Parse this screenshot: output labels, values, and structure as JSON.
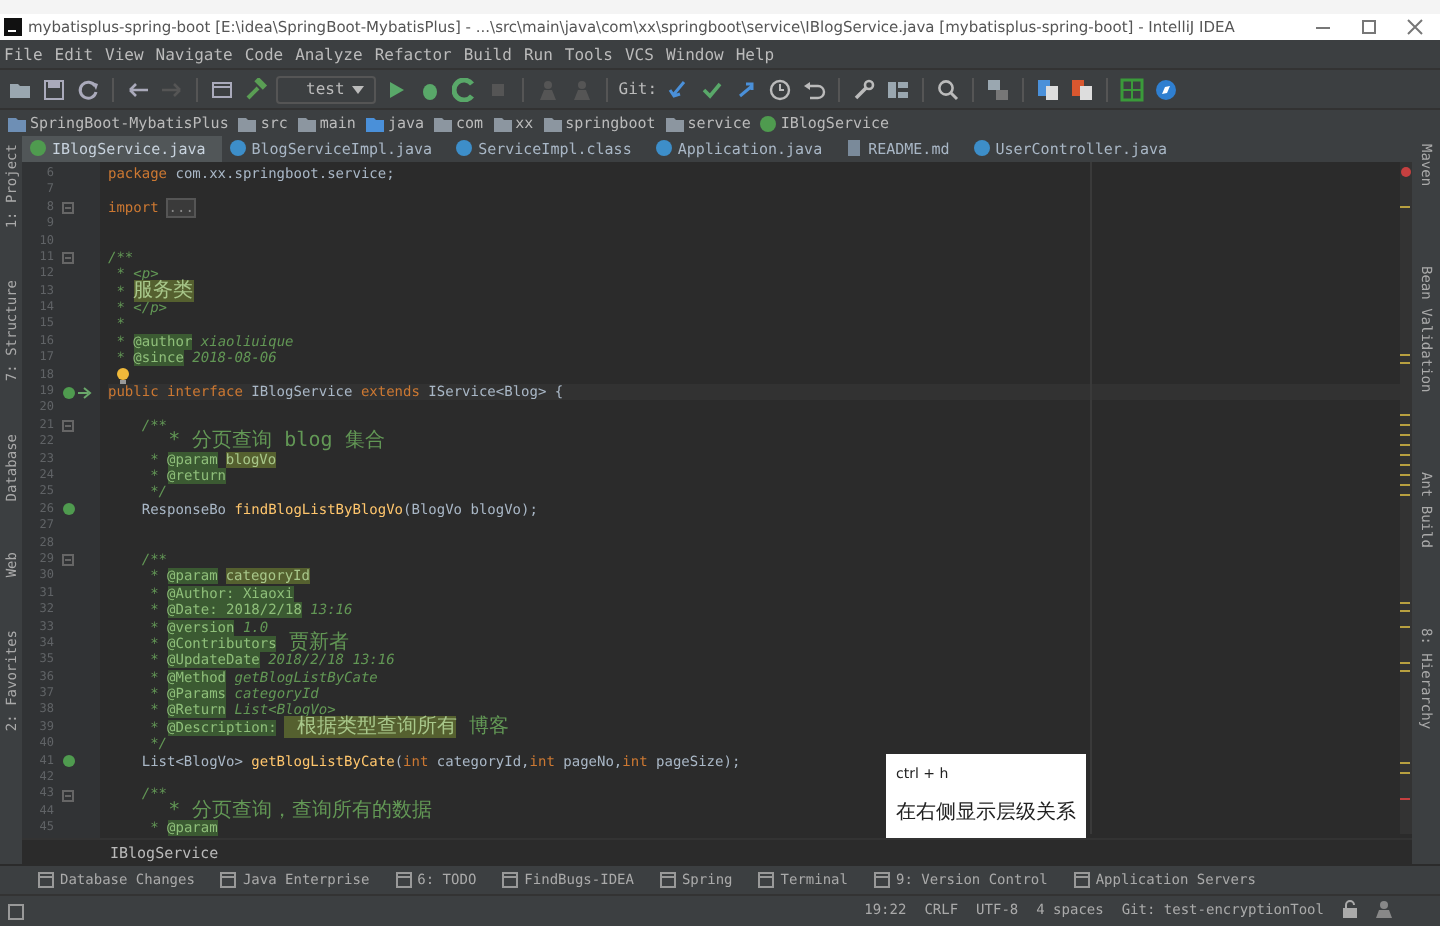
{
  "window": {
    "title": "mybatisplus-spring-boot [E:\\idea\\SpringBoot-MybatisPlus] - ...\\src\\main\\java\\com\\xx\\springboot\\service\\IBlogService.java [mybatisplus-spring-boot] - IntelliJ IDEA"
  },
  "menu": [
    "File",
    "Edit",
    "View",
    "Navigate",
    "Code",
    "Analyze",
    "Refactor",
    "Build",
    "Run",
    "Tools",
    "VCS",
    "Window",
    "Help"
  ],
  "toolbar": {
    "run_config": "test",
    "vcs_label": "Git:"
  },
  "navigation": [
    {
      "label": "SpringBoot-MybatisPlus",
      "kind": "module"
    },
    {
      "label": "src",
      "kind": "folder"
    },
    {
      "label": "main",
      "kind": "folder"
    },
    {
      "label": "java",
      "kind": "source"
    },
    {
      "label": "com",
      "kind": "folder"
    },
    {
      "label": "xx",
      "kind": "folder"
    },
    {
      "label": "springboot",
      "kind": "folder"
    },
    {
      "label": "service",
      "kind": "folder"
    },
    {
      "label": "IBlogService",
      "kind": "interface"
    }
  ],
  "tabs": [
    {
      "label": "IBlogService.java",
      "kind": "interface",
      "selected": true
    },
    {
      "label": "BlogServiceImpl.java",
      "kind": "class",
      "selected": false
    },
    {
      "label": "ServiceImpl.class",
      "kind": "class",
      "selected": false
    },
    {
      "label": "Application.java",
      "kind": "class",
      "selected": false
    },
    {
      "label": "README.md",
      "kind": "markdown",
      "selected": false
    },
    {
      "label": "UserController.java",
      "kind": "class",
      "selected": false
    }
  ],
  "left_tools": [
    "1: Project",
    "7: Structure",
    "Database",
    "Web",
    "2: Favorites"
  ],
  "right_tools": [
    "Maven",
    "Bean Validation",
    "Ant Build",
    "8: Hierarchy"
  ],
  "code": [
    {
      "number": "6",
      "tokens": [
        {
          "text": "package",
          "kind": "keyword"
        },
        {
          "text": " com.xx.springboot.service;",
          "kind": "plain"
        }
      ]
    },
    {
      "number": "7"
    },
    {
      "number": "8",
      "foldable": true,
      "tokens": [
        {
          "text": "import",
          "kind": "keyword"
        },
        {
          "text": "...",
          "kind": "folded"
        }
      ]
    },
    {
      "number": "9"
    },
    {
      "number": "10"
    },
    {
      "number": "11",
      "foldable": true,
      "tokens": [
        {
          "text": "/**",
          "kind": "doc"
        }
      ]
    },
    {
      "number": "12",
      "tokens": [
        {
          "text": " * <p>",
          "kind": "doc"
        }
      ]
    },
    {
      "number": "13",
      "tokens": [
        {
          "text": " * ",
          "kind": "doc"
        },
        {
          "text": "服务类",
          "kind": "param"
        }
      ]
    },
    {
      "number": "14",
      "tokens": [
        {
          "text": " * </p>",
          "kind": "doc"
        }
      ]
    },
    {
      "number": "15",
      "tokens": [
        {
          "text": " *",
          "kind": "doc"
        }
      ]
    },
    {
      "number": "16",
      "tokens": [
        {
          "text": " * ",
          "kind": "doc"
        },
        {
          "text": "@author",
          "kind": "tag"
        },
        {
          "text": " xiaoliuique",
          "kind": "doc"
        }
      ]
    },
    {
      "number": "17",
      "tokens": [
        {
          "text": " * ",
          "kind": "doc"
        },
        {
          "text": "@since",
          "kind": "tag"
        },
        {
          "text": " 2018-08-06",
          "kind": "doc"
        }
      ]
    },
    {
      "number": "18",
      "intention": true
    },
    {
      "number": "19",
      "has_implementations": true,
      "current": true,
      "tokens": [
        {
          "text": "public interface ",
          "kind": "keyword"
        },
        {
          "text": "IBlogService ",
          "kind": "plain"
        },
        {
          "text": "extends ",
          "kind": "keyword"
        },
        {
          "text": "IService<Blog> {",
          "kind": "plain"
        }
      ]
    },
    {
      "number": "20"
    },
    {
      "number": "21",
      "foldable": true,
      "tokens": [
        {
          "text": "    /**",
          "kind": "doc"
        }
      ]
    },
    {
      "number": "22",
      "tokens": [
        {
          "text": "     * 分页查询 blog 集合",
          "kind": "doc"
        }
      ]
    },
    {
      "number": "23",
      "tokens": [
        {
          "text": "     * ",
          "kind": "doc"
        },
        {
          "text": "@param",
          "kind": "tag"
        },
        {
          "text": "blogVo",
          "kind": "param"
        }
      ]
    },
    {
      "number": "24",
      "tokens": [
        {
          "text": "     * ",
          "kind": "doc"
        },
        {
          "text": "@return",
          "kind": "tag"
        }
      ]
    },
    {
      "number": "25",
      "tokens": [
        {
          "text": "     */",
          "kind": "doc"
        }
      ]
    },
    {
      "number": "26",
      "implemented": true,
      "tokens": [
        {
          "text": "    ResponseBo ",
          "kind": "plain"
        },
        {
          "text": "findBlogListByBlogVo",
          "kind": "method"
        },
        {
          "text": "(BlogVo blogVo);",
          "kind": "plain"
        }
      ]
    },
    {
      "number": "27"
    },
    {
      "number": "28"
    },
    {
      "number": "29",
      "foldable": true,
      "tokens": [
        {
          "text": "    /**",
          "kind": "doc"
        }
      ]
    },
    {
      "number": "30",
      "tokens": [
        {
          "text": "     * ",
          "kind": "doc"
        },
        {
          "text": "@param",
          "kind": "tag"
        },
        {
          "text": "categoryId",
          "kind": "param"
        }
      ]
    },
    {
      "number": "31",
      "tokens": [
        {
          "text": "     * ",
          "kind": "doc"
        },
        {
          "text": "@Author: Xiaoxi",
          "kind": "tag"
        }
      ]
    },
    {
      "number": "32",
      "tokens": [
        {
          "text": "     * ",
          "kind": "doc"
        },
        {
          "text": "@Date: 2018/2/18",
          "kind": "tag"
        },
        {
          "text": " 13:16",
          "kind": "doc"
        }
      ]
    },
    {
      "number": "33",
      "tokens": [
        {
          "text": "     * ",
          "kind": "doc"
        },
        {
          "text": "@version",
          "kind": "tag"
        },
        {
          "text": " 1.0",
          "kind": "doc"
        }
      ]
    },
    {
      "number": "34",
      "tokens": [
        {
          "text": "     * ",
          "kind": "doc"
        },
        {
          "text": "@Contributors",
          "kind": "tag"
        },
        {
          "text": " 贾新者",
          "kind": "doc"
        }
      ]
    },
    {
      "number": "35",
      "tokens": [
        {
          "text": "     * ",
          "kind": "doc"
        },
        {
          "text": "@UpdateDate",
          "kind": "tag"
        },
        {
          "text": " 2018/2/18 13:16",
          "kind": "doc"
        }
      ]
    },
    {
      "number": "36",
      "tokens": [
        {
          "text": "     * ",
          "kind": "doc"
        },
        {
          "text": "@Method",
          "kind": "tag"
        },
        {
          "text": " getBlogListByCate",
          "kind": "doc"
        }
      ]
    },
    {
      "number": "37",
      "tokens": [
        {
          "text": "     * ",
          "kind": "doc"
        },
        {
          "text": "@Params",
          "kind": "tag"
        },
        {
          "text": " categoryId",
          "kind": "doc"
        }
      ]
    },
    {
      "number": "38",
      "tokens": [
        {
          "text": "     * ",
          "kind": "doc"
        },
        {
          "text": "@Return",
          "kind": "tag"
        },
        {
          "text": " List<BlogVo>",
          "kind": "doc"
        }
      ]
    },
    {
      "number": "39",
      "tokens": [
        {
          "text": "     * ",
          "kind": "doc"
        },
        {
          "text": "@Description:",
          "kind": "tag"
        },
        {
          "text": " 根据类型查询所有",
          "kind": "param"
        },
        {
          "text": " 博客",
          "kind": "doc"
        }
      ]
    },
    {
      "number": "40",
      "tokens": [
        {
          "text": "     */",
          "kind": "doc"
        }
      ]
    },
    {
      "number": "41",
      "implemented": true,
      "tokens": [
        {
          "text": "    List<BlogVo> ",
          "kind": "plain"
        },
        {
          "text": "getBlogListByCate",
          "kind": "method"
        },
        {
          "text": "(",
          "kind": "plain"
        },
        {
          "text": "int",
          "kind": "keyword"
        },
        {
          "text": " categoryId,",
          "kind": "plain"
        },
        {
          "text": "int",
          "kind": "keyword"
        },
        {
          "text": " pageNo,",
          "kind": "plain"
        },
        {
          "text": "int",
          "kind": "keyword"
        },
        {
          "text": " pageSize);",
          "kind": "plain"
        }
      ]
    },
    {
      "number": "42"
    },
    {
      "number": "43",
      "foldable": true,
      "tokens": [
        {
          "text": "    /**",
          "kind": "doc"
        }
      ]
    },
    {
      "number": "44",
      "tokens": [
        {
          "text": "     * 分页查询，查询所有的数据",
          "kind": "doc"
        }
      ]
    },
    {
      "number": "45",
      "tokens": [
        {
          "text": "     * ",
          "kind": "doc"
        },
        {
          "text": "@param",
          "kind": "tag"
        }
      ]
    }
  ],
  "editor_breadcrumb": "IBlogService",
  "tooltip": {
    "shortcut": "ctrl + h",
    "description": "在右侧显示层级关系"
  },
  "tool_windows": [
    "Database Changes",
    "Java Enterprise",
    "6: TODO",
    "FindBugs-IDEA",
    "Spring",
    "Terminal",
    "9: Version Control",
    "Application Servers"
  ],
  "status_bar": [
    "19:22",
    "CRLF",
    "UTF-8",
    "4 spaces",
    "Git: test-encryptionTool"
  ]
}
